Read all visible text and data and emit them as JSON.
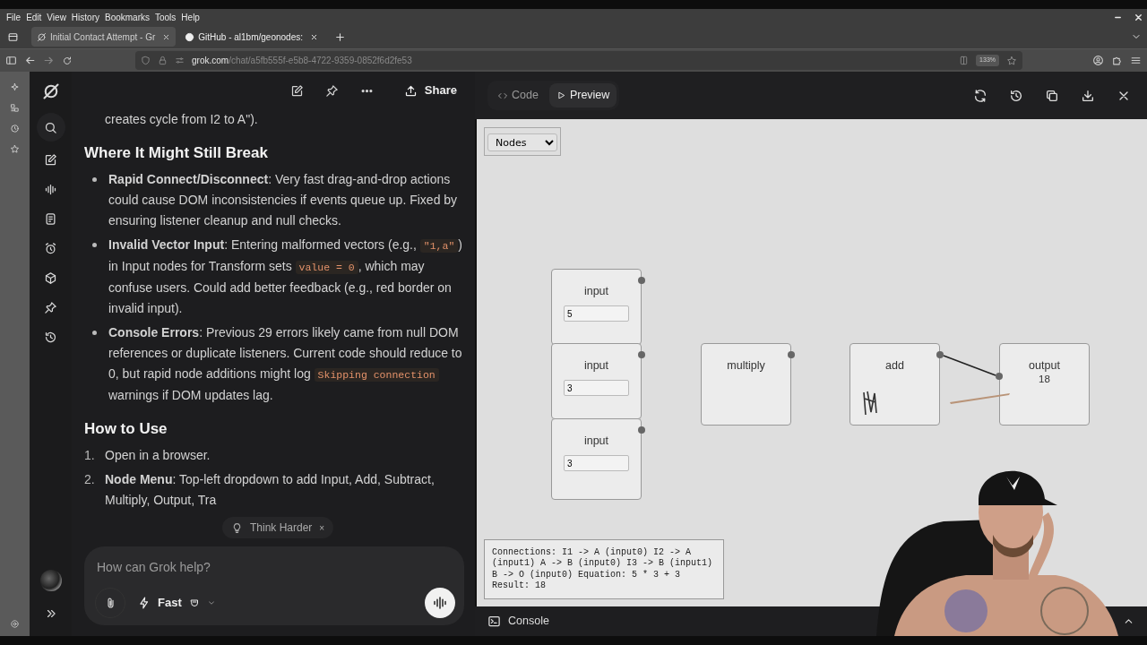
{
  "menu": [
    "File",
    "Edit",
    "View",
    "History",
    "Bookmarks",
    "Tools",
    "Help"
  ],
  "tabs": [
    {
      "title": "Initial Contact Attempt - Gr",
      "selected": true
    },
    {
      "title": "GitHub - al1bm/geonodes:",
      "selected": false
    }
  ],
  "address": {
    "host": "grok.com",
    "path": "/chat/a5fb555f-e5b8-4722-9359-0852f6d2fe53"
  },
  "zoom": "133%",
  "chat": {
    "share": "Share",
    "blocks": [
      {
        "kind": "continuation",
        "segments": [
          {
            "kind": "plain",
            "text": "creates cycle from I2 to A\")."
          }
        ]
      },
      {
        "kind": "heading",
        "segments": [
          {
            "kind": "plain",
            "text": "Where It Might Still Break"
          }
        ]
      },
      {
        "kind": "bullet",
        "segments": [
          {
            "kind": "bold",
            "text": "Rapid Connect/Disconnect"
          },
          {
            "kind": "plain",
            "text": ": Very fast drag-and-drop actions could cause DOM inconsistencies if events queue up. Fixed by ensuring listener cleanup and null checks."
          }
        ]
      },
      {
        "kind": "bullet",
        "segments": [
          {
            "kind": "bold",
            "text": "Invalid Vector Input"
          },
          {
            "kind": "plain",
            "text": ": Entering malformed vectors (e.g., "
          },
          {
            "kind": "code",
            "text": "\"1,a\""
          },
          {
            "kind": "plain",
            "text": ") in Input nodes for Transform sets "
          },
          {
            "kind": "code",
            "text": "value = 0"
          },
          {
            "kind": "plain",
            "text": ", which may confuse users. Could add better feedback (e.g., red border on invalid input)."
          }
        ]
      },
      {
        "kind": "bullet",
        "segments": [
          {
            "kind": "bold",
            "text": "Console Errors"
          },
          {
            "kind": "plain",
            "text": ": Previous 29 errors likely came from null DOM references or duplicate listeners. Current code should reduce to 0, but rapid node additions might log "
          },
          {
            "kind": "code",
            "text": "Skipping connection"
          },
          {
            "kind": "plain",
            "text": " warnings if DOM updates lag."
          }
        ]
      },
      {
        "kind": "heading",
        "segments": [
          {
            "kind": "plain",
            "text": "How to Use"
          }
        ]
      },
      {
        "kind": "numbered",
        "number": "1.",
        "segments": [
          {
            "kind": "plain",
            "text": "Open in a browser."
          }
        ]
      },
      {
        "kind": "numbered",
        "number": "2.",
        "segments": [
          {
            "kind": "bold",
            "text": "Node Menu"
          },
          {
            "kind": "plain",
            "text": ": Top-left dropdown to add Input, Add, Subtract, Multiply, Output, Tra"
          }
        ]
      }
    ],
    "hint": "Think Harder",
    "hint_close": "×",
    "composer": {
      "placeholder": "How can Grok help?",
      "mode": "Fast"
    }
  },
  "preview": {
    "tabs": [
      {
        "label": "Code",
        "selected": false
      },
      {
        "label": "Preview",
        "selected": true
      }
    ],
    "node_menu": "Nodes",
    "nodes": [
      {
        "kind": "input",
        "title": "input",
        "value": "5"
      },
      {
        "kind": "input",
        "title": "input",
        "value": "3"
      },
      {
        "kind": "input",
        "title": "input",
        "value": "3"
      },
      {
        "kind": "operator",
        "title": "multiply"
      },
      {
        "kind": "operator",
        "title": "add"
      },
      {
        "kind": "output",
        "title": "output",
        "result": "18"
      }
    ],
    "log": "Connections: I1 -> A (input0) I2 -> A (input1) A -> B (input0) I3 -> B (input1) B -> O (input0) Equation: 5 * 3 + 3 Result: 18",
    "console": "Console"
  }
}
